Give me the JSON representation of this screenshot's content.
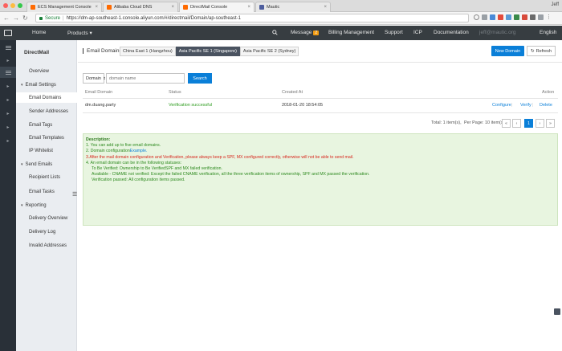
{
  "browser": {
    "tabs": [
      {
        "title": "ECS Management Console",
        "color": "#ff6a00"
      },
      {
        "title": "Alibaba Cloud DNS",
        "color": "#ff6a00"
      },
      {
        "title": "DirectMail Console",
        "color": "#ff6a00"
      },
      {
        "title": "Mautic",
        "color": "#4e5e9e"
      }
    ],
    "profile": "Jeff",
    "secure_label": "Secure",
    "url": "https://dm-ap-southeast-1.console.aliyun.com/#/directmail/Domain/ap-southeast-1"
  },
  "topnav": {
    "home": "Home",
    "products": "Products",
    "message": "Message",
    "message_count": "2",
    "billing": "Billing Management",
    "support": "Support",
    "icp": "ICP",
    "documentation": "Documentation",
    "user": "jeff@mautic.org",
    "language": "English"
  },
  "sidebar": {
    "title": "DirectMail",
    "overview": "Overview",
    "email_settings": "Email Settings",
    "email_domains": "Email Domains",
    "sender_addresses": "Sender Addresses",
    "email_tags": "Email Tags",
    "email_templates": "Email Templates",
    "ip_whitelist": "IP Whitelist",
    "send_emails": "Send Emails",
    "recipient_lists": "Recipient Lists",
    "email_tasks": "Email Tasks",
    "reporting": "Reporting",
    "delivery_overview": "Delivery Overview",
    "delivery_log": "Delivery Log",
    "invalid_addresses": "Invalid Addresses"
  },
  "main": {
    "title": "Email Domains",
    "regions": [
      "China East 1 (Hangzhou)",
      "Asia Pacific SE 1 (Singapore)",
      "Asia Pacific SE 2 (Sydney)"
    ],
    "new_domain": "New Domain",
    "refresh": "Refresh",
    "filter_select": "Domain",
    "search_placeholder": "domain name",
    "search_button": "Search",
    "table": {
      "headers": {
        "domain": "Email Domain",
        "status": "Status",
        "created": "Created At",
        "action": "Action"
      },
      "rows": [
        {
          "domain": "dm.duang.party",
          "status": "Verification successful",
          "created": "2018-01-20 18:54:05",
          "configure": "Configure",
          "verify": "Verify",
          "delete": "Delete"
        }
      ]
    },
    "pager": {
      "total": "Total: 1 item(s),",
      "per_page": "Per Page: 10 item(s)",
      "first": "«",
      "prev": "‹",
      "current": "1",
      "next": "›",
      "last": "»"
    },
    "description": {
      "heading": "Description:",
      "line1": "1. You can add up to five email domains.",
      "line2_prefix": "2. Domain configuration",
      "line2_link": "Example.",
      "line3": "3.After the mail domain configuration and Verification,   please always keep a SPF, MX configured correctly, otherwise will not be able to send mail.",
      "line4": "4. An email domain can be in the following statuses:",
      "status1": "To Be Verified: Ownership to Be VerifiedSPF and MX failed verification.",
      "status2": "Available - CNAME not verified: Except the failed CNAME verification, all the three verification items of ownership, SPF and MX passed the verification.",
      "status3": "Verification passed: All configuration items passed."
    }
  }
}
